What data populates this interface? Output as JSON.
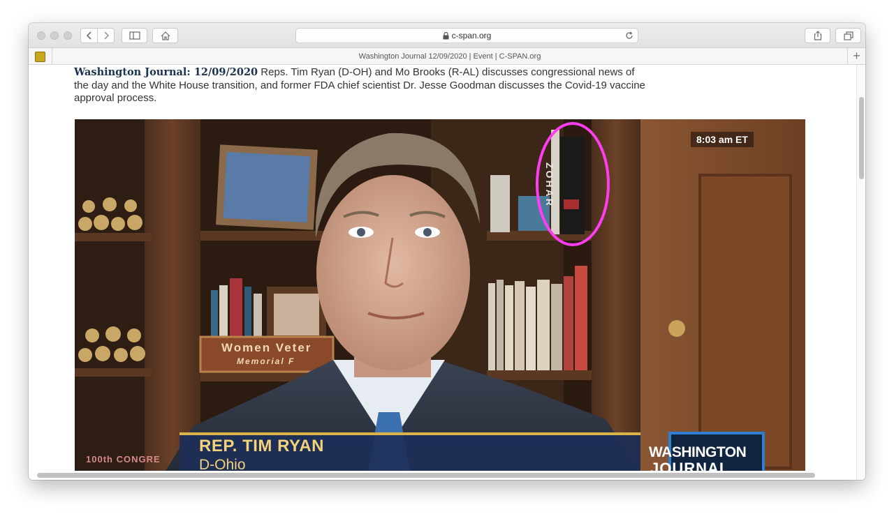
{
  "browser": {
    "address": "c-span.org",
    "tab_title": "Washington Journal 12/09/2020 | Event | C-SPAN.org",
    "new_tab_label": "+"
  },
  "page": {
    "program_title": "Washington Journal: 12/09/2020",
    "description": " Reps. Tim Ryan (D-OH) and Mo Brooks (R-AL) discusses congressional news of the day and the White House transition, and former FDA chief scientist Dr. Jesse Goodman discusses the Covid-19 vaccine approval process."
  },
  "video": {
    "timestamp": "8:03 am ET",
    "lower_third_name": "REP. TIM RYAN",
    "lower_third_subtitle": "D-Ohio",
    "network_logo_line1": "WASHINGTON",
    "network_logo_line2": "JOURNAL",
    "book_spine_text": "ZOHAR",
    "plaque_line1": "Women Veter",
    "plaque_line2": "Memorial F",
    "frame_text": "100th CONGRE"
  },
  "colors": {
    "highlight_circle": "#ff3df0",
    "lower_third_bg": "#1d2f58",
    "lower_third_accent": "#d9b24a",
    "logo_border": "#2f7fd1",
    "title_color": "#1b3350"
  }
}
